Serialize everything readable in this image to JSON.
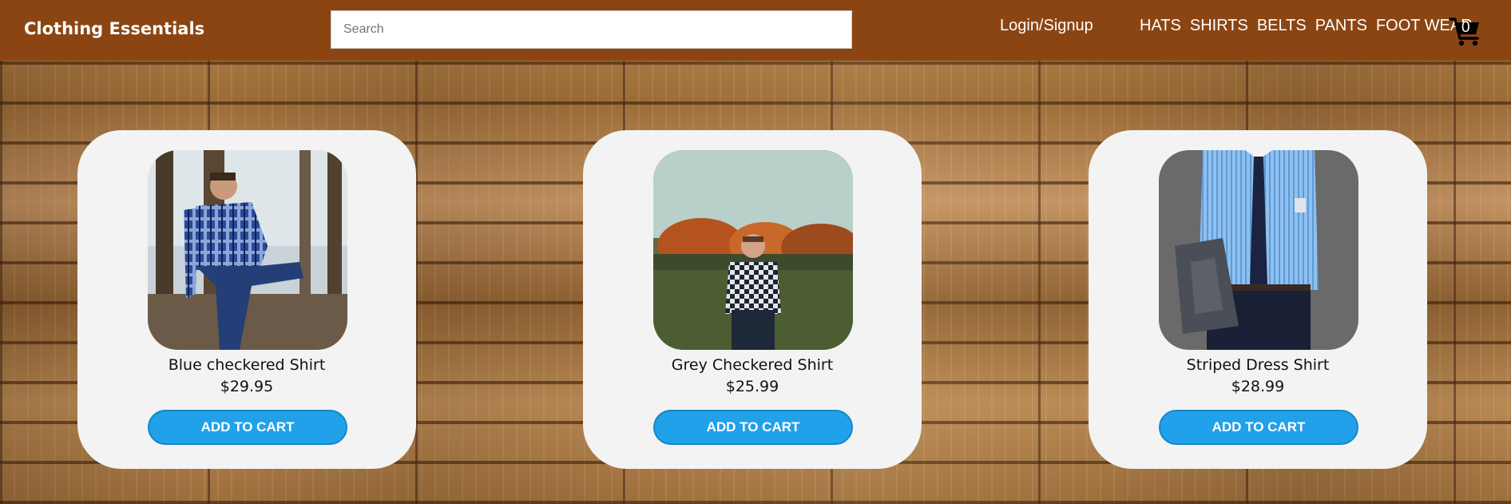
{
  "header": {
    "brand": "Clothing Essentials",
    "search_placeholder": "Search",
    "search_value": "",
    "login_label": "Login/Signup",
    "menu": [
      "HATS",
      "SHIRTS",
      "BELTS",
      "PANTS",
      "FOOT WEAR"
    ],
    "cart_count": "0",
    "cart_icon": "shopping-cart-icon",
    "bar_color": "#8b4513"
  },
  "products": [
    {
      "name": "Blue checkered Shirt",
      "price": "$29.95",
      "button": "ADD TO CART"
    },
    {
      "name": "Grey Checkered Shirt",
      "price": "$25.99",
      "button": "ADD TO CART"
    },
    {
      "name": "Striped Dress Shirt",
      "price": "$28.99",
      "button": "ADD TO CART"
    }
  ],
  "colors": {
    "button": "#20a1ea",
    "card": "#f3f3f3"
  }
}
